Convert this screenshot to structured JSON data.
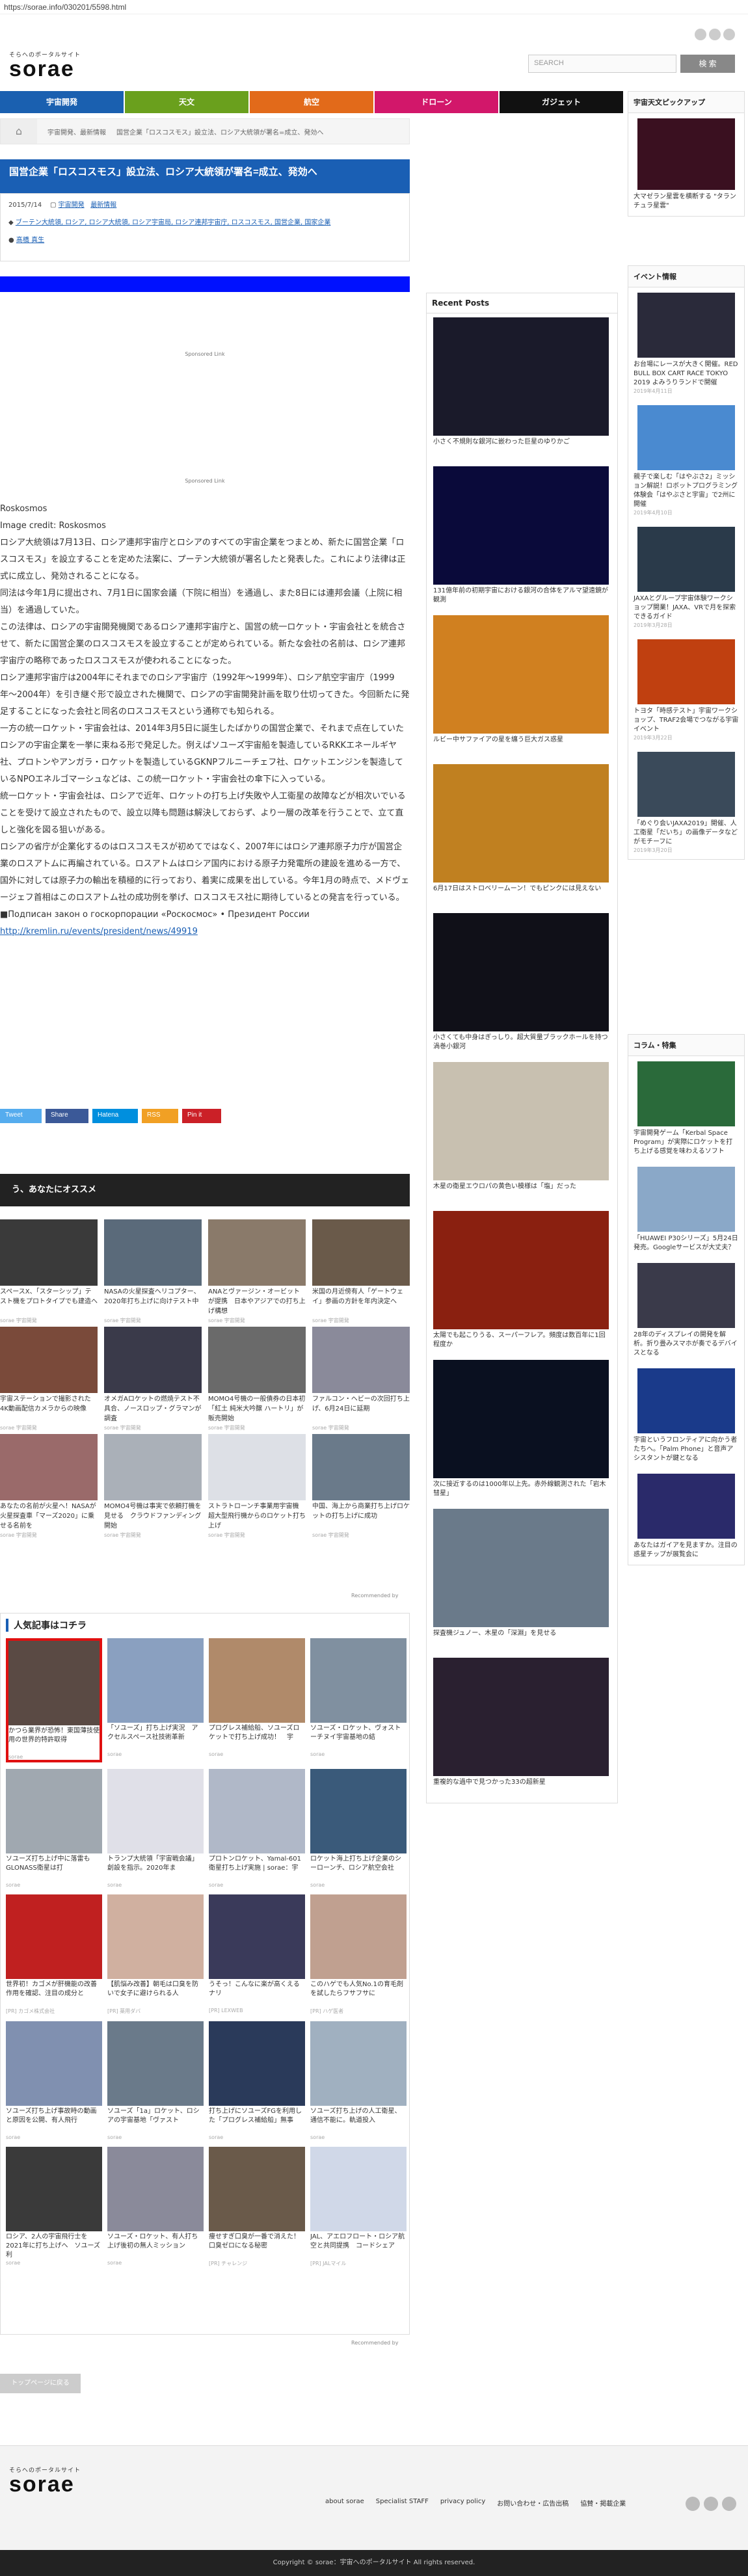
{
  "url": "https://sorae.info/030201/5598.html",
  "header": {
    "logo_sub": "そらへのポータルサイト",
    "logo_main": "sorae",
    "search_placeholder": "SEARCH",
    "search_button": "検 索"
  },
  "nav": [
    "宇宙開発",
    "天文",
    "航空",
    "ドローン",
    "ガジェット"
  ],
  "breadcrumb": [
    "宇宙開発、最新情報",
    "国営企業「ロスコスモス」設立法、ロシア大統領が署名=成立、発効へ"
  ],
  "article": {
    "title": "国営企業「ロスコスモス」設立法、ロシア大統領が署名=成立、発効へ",
    "date": "2015/7/14",
    "categories": [
      "宇宙開発",
      "最新情報"
    ],
    "tags": "ブーテン大統領, ロシア, ロシア大統領, ロシア宇宙局, ロシア連邦宇宙庁, ロスコスモス, 国営企業, 国家企業",
    "author": "髙橋 真生",
    "sponsored": "Sponsored Link",
    "image_alt": "Roskosmos",
    "credit": "Image credit: Roskosmos",
    "paragraphs": [
      "ロシア大統領は7月13日、ロシア連邦宇宙庁とロシアのすべての宇宙企業をつまとめ、新たに国営企業「ロスコスモス」を設立することを定めた法案に、プーテン大統領が署名したと発表した。これにより法律は正式に成立し、発効されることになる。",
      "同法は今年1月に提出され、7月1日に国家会議（下院に相当）を通過し、また8日には連邦会議（上院に相当）を通過していた。",
      "この法律は、ロシアの宇宙開発機関であるロシア連邦宇宙庁と、国営の統一ロケット・宇宙会社とを統合させて、新たに国営企業のロスコスモスを設立することが定められている。新たな会社の名前は、ロシア連邦宇宙庁の略称であったロスコスモスが使われることになった。",
      "ロシア連邦宇宙庁は2004年にそれまでのロシア宇宙庁（1992年〜1999年）、ロシア航空宇宙庁（1999年〜2004年）を引き継ぐ形で設立された機関で、ロシアの宇宙開発計画を取り仕切ってきた。今回新たに発足することになった会社と同名のロスコスモスという通称でも知られる。",
      "一方の統一ロケット・宇宙会社は、2014年3月5日に誕生したばかりの国営企業で、それまで点在していたロシアの宇宙企業を一挙に束ねる形で発足した。例えばソユーズ宇宙船を製造しているRKKエネールギヤ社、プロトンやアンガラ・ロケットを製造しているGKNPフルニーチェフ社、ロケットエンジンを製造しているNPOエネルゴマーシュなどは、この統一ロケット・宇宙会社の傘下に入っている。",
      "統一ロケット・宇宙会社は、ロシアで近年、ロケットの打ち上げ失敗や人工衛星の故障などが相次いでいることを受けて設立されたもので、設立以降も問題は解決しておらず、より一層の改革を行うことで、立て直しと強化を図る狙いがある。",
      "ロシアの省庁が企業化するのはロスコスモスが初めてではなく、2007年にはロシア連邦原子力庁が国営企業のロスアトムに再編されている。ロスアトムはロシア国内における原子力発電所の建設を進める一方で、国外に対しては原子力の輸出を積極的に行っており、着実に成果を出している。今年1月の時点で、メドヴェージェフ首相はこのロスアトム社の成功例を挙げ、ロスコスモス社に期待しているとの発言を行っている。"
    ],
    "source_line": "■Подписан закон о госкорпорации «Роскосмос» • Президент России",
    "source_url": "http://kremlin.ru/events/president/news/49919"
  },
  "share": [
    "Tweet",
    "Share",
    "Hatena",
    "RSS",
    "Pin it"
  ],
  "recommend": {
    "title": "う、あなたにオススメ",
    "footer": "Recommended by",
    "items": [
      {
        "t": "スペースX、「スターシップ」テスト機をプロトタイプでも建造へ",
        "s": "sorae 宇宙開発"
      },
      {
        "t": "NASAの火星探査ヘリコプター、2020年打ち上げに向けテスト中",
        "s": "sorae 宇宙開発"
      },
      {
        "t": "ANAとヴァージン・オービットが提携　日本やアジアでの打ち上げ構想",
        "s": "sorae 宇宙開発"
      },
      {
        "t": "米国の月近傍有人「ゲートウェイ」参画の方針を年内決定へ",
        "s": "sorae 宇宙開発"
      },
      {
        "t": "宇宙ステーションで撮影された4K動画配信カメラからの映像",
        "s": "sorae 宇宙開発"
      },
      {
        "t": "オメガAロケットの燃焼テスト不具合、ノースロップ・グラマンが調査",
        "s": "sorae 宇宙開発"
      },
      {
        "t": "MOMO4号機の一般債券の日本初「紅土 純米大吟醸 ハートリ」が販売開始",
        "s": "sorae 宇宙開発"
      },
      {
        "t": "ファルコン・ヘビーの次回打ち上げ、6月24日に延期",
        "s": "sorae 宇宙開発"
      },
      {
        "t": "あなたの名前が火星へ！NASAが火星探査車「マーズ2020」に乗せる名前を",
        "s": "sorae 宇宙開発"
      },
      {
        "t": "MOMO4号機は事実で依頼打機を見せる　クラウドファンディング開始",
        "s": "sorae 宇宙開発"
      },
      {
        "t": "ストラトローンチ事業用宇宙機　超大型飛行機からのロケット打ち上げ",
        "s": "sorae 宇宙開発"
      },
      {
        "t": "中国、海上から商業打ち上げロケットの打ち上げに成功",
        "s": "sorae 宇宙開発"
      }
    ]
  },
  "popular": {
    "title": "人気記事はコチラ",
    "footer": "Recommended by",
    "items": [
      {
        "t": "かつら業界が恐怖！東国薄技使用の世界的特許取得",
        "s": "sorae"
      },
      {
        "t": "「ソユーズ」打ち上げ実況　アクセルスペース社技術革新",
        "s": "sorae"
      },
      {
        "t": "プログレス補給船、ソユーズロケットで打ち上げ成功！　宇",
        "s": "sorae"
      },
      {
        "t": "ソユーズ・ロケット、ヴォストーチヌイ宇宙基地の結",
        "s": "sorae"
      },
      {
        "t": "ソユーズ打ち上げ中に落雷も GLONASS衛星は打",
        "s": "sorae"
      },
      {
        "t": "トランプ大統領「宇宙戦会議」創設を指示。2020年ま",
        "s": "sorae"
      },
      {
        "t": "プロトンロケット、Yamal-601衛星打ち上げ実施 | sorae：宇",
        "s": "sorae"
      },
      {
        "t": "ロケット海上打ち上げ企業のシーローンチ、ロシア航空会社",
        "s": "sorae"
      },
      {
        "t": "世界初！カゴメが肝機能の改善作用を確認、注目の成分と",
        "s": "[PR] カゴメ株式会社"
      },
      {
        "t": "【肌悩み改善】朝毛は口臭を防いで女子に避けられる人",
        "s": "[PR] 薬用ダバ"
      },
      {
        "t": "うそっ！こんなに楽が高くえるナリ",
        "s": "[PR] LEXWEB"
      },
      {
        "t": "このハゲでも人気No.1の育毛剤を試したらフサフサに",
        "s": "[PR] ハゲ医者"
      },
      {
        "t": "ソユーズ打ち上げ事故時の動画と原因を公開、有人飛行",
        "s": "sorae"
      },
      {
        "t": "ソユーズ「1a」ロケット、ロシアの宇宙基地「ヴァスト",
        "s": "sorae"
      },
      {
        "t": "打ち上げにソユーズFGを利用した「プログレス補給船」無事",
        "s": "sorae"
      },
      {
        "t": "ソユーズ打ち上げの人工衛星、通信不能に。軌道投入",
        "s": "sorae"
      },
      {
        "t": "ロシア、2人の宇宙飛行士を2021年に打ち上げへ　ソユーズ利",
        "s": "sorae"
      },
      {
        "t": "ソユーズ・ロケット、有人打ち上げ後初の無人ミッション",
        "s": "sorae"
      },
      {
        "t": "痩せすぎ口臭が一番で消えた！口臭ゼロになる秘密",
        "s": "[PR] チャレンジ"
      },
      {
        "t": "JAL、アエロフロート・ロシア航空と共同提携　コードシェア",
        "s": "[PR] JALマイル"
      }
    ]
  },
  "recent": {
    "title": "Recent Posts",
    "items": [
      "小さく不規則な銀河に嵌わった巨星のゆりかご",
      "131億年前の初期宇宙における銀河の合体をアルマ望遠鏡が観測",
      "ルビー中サファイアの星を纏う巨大ガス惑星",
      "6月17日はストロベリームーン！でもピンクには見えない",
      "小さくても中身はぎっしり。超大質量ブラックホールを持つ渦巻小銀河",
      "木星の衛星エウロパの黄色い模様は「塩」だった",
      "太陽でも起こりうる、スーパーフレア。頻度は数百年に1回程度か",
      "次に接近するのは1000年以上先。赤外線観測された「岩木彗星」",
      "探査機ジュノー、木星の「深淵」を見せる",
      "重複的な過中で見つかった33の超新星"
    ]
  },
  "pickup": {
    "title": "宇宙天文ピックアップ",
    "items": [
      {
        "t": "大マゼラン星雲を横断する \"タランチュラ星雲\"",
        "d": ""
      }
    ]
  },
  "events": {
    "title": "イベント情報",
    "items": [
      {
        "t": "お台場にレースが大きく開催。RED BULL BOX CART RACE TOKYO 2019 よみうりランドで開催",
        "d": "2019年4月11日"
      },
      {
        "t": "親子で楽しむ「はやぶさ2」ミッション解説！ロボットプログラミング体験会「はやぶさと宇宙」で2州に開催",
        "d": "2019年4月10日"
      },
      {
        "t": "JAXAとグループ宇宙体験ワークショップ開業！JAXA、VRで月を探索できるガイド",
        "d": "2019年3月28日"
      },
      {
        "t": "トヨタ「時感テスト」宇宙ワークショップ、TRAF2会場でつながる宇宙イベント",
        "d": "2019年3月22日"
      },
      {
        "t": "「めぐり会いJAXA2019」開催、人工衛星「だいち」の画像データなどがモチーフに",
        "d": "2019年3月20日"
      }
    ]
  },
  "column": {
    "title": "コラム・特集",
    "items": [
      {
        "t": "宇宙開発ゲーム「Kerbal Space Program」が実際にロケットを打ち上げる感覚を味わえるソフト",
        "d": ""
      },
      {
        "t": "「HUAWEI P30シリーズ」5月24日発売。Googleサービスが大丈夫？",
        "d": ""
      },
      {
        "t": "28年のディスプレイの開発を解析。折り畳みスマホが奏でるデバイスとなる",
        "d": ""
      },
      {
        "t": "宇宙というフロンティアに向かう者たちへ。「Palm Phone」と音声アシスタントが鍵となる",
        "d": ""
      },
      {
        "t": "あなたはガイアを見ますか。注目の惑星チップが展覧会に",
        "d": ""
      }
    ]
  },
  "footer": {
    "logo_sub": "そらへのポータルサイト",
    "logo_main": "sorae",
    "links": [
      "about sorae",
      "Specialist STAFF",
      "privacy policy",
      "お問い合わせ・広告出稿",
      "協賛・掲載企業"
    ],
    "copyright": "Copyright © sorae：宇宙へのポータルサイト All rights reserved.",
    "top_button": "トップページに戻る"
  },
  "colors": {
    "brand_blue": "#1a5fb4",
    "nav_space": "#1a60b0",
    "nav_astro": "#6aa01d",
    "nav_air": "#e26a1a",
    "nav_drone": "#d2176a",
    "nav_gadget": "#111111",
    "highlight": "#e01010"
  }
}
